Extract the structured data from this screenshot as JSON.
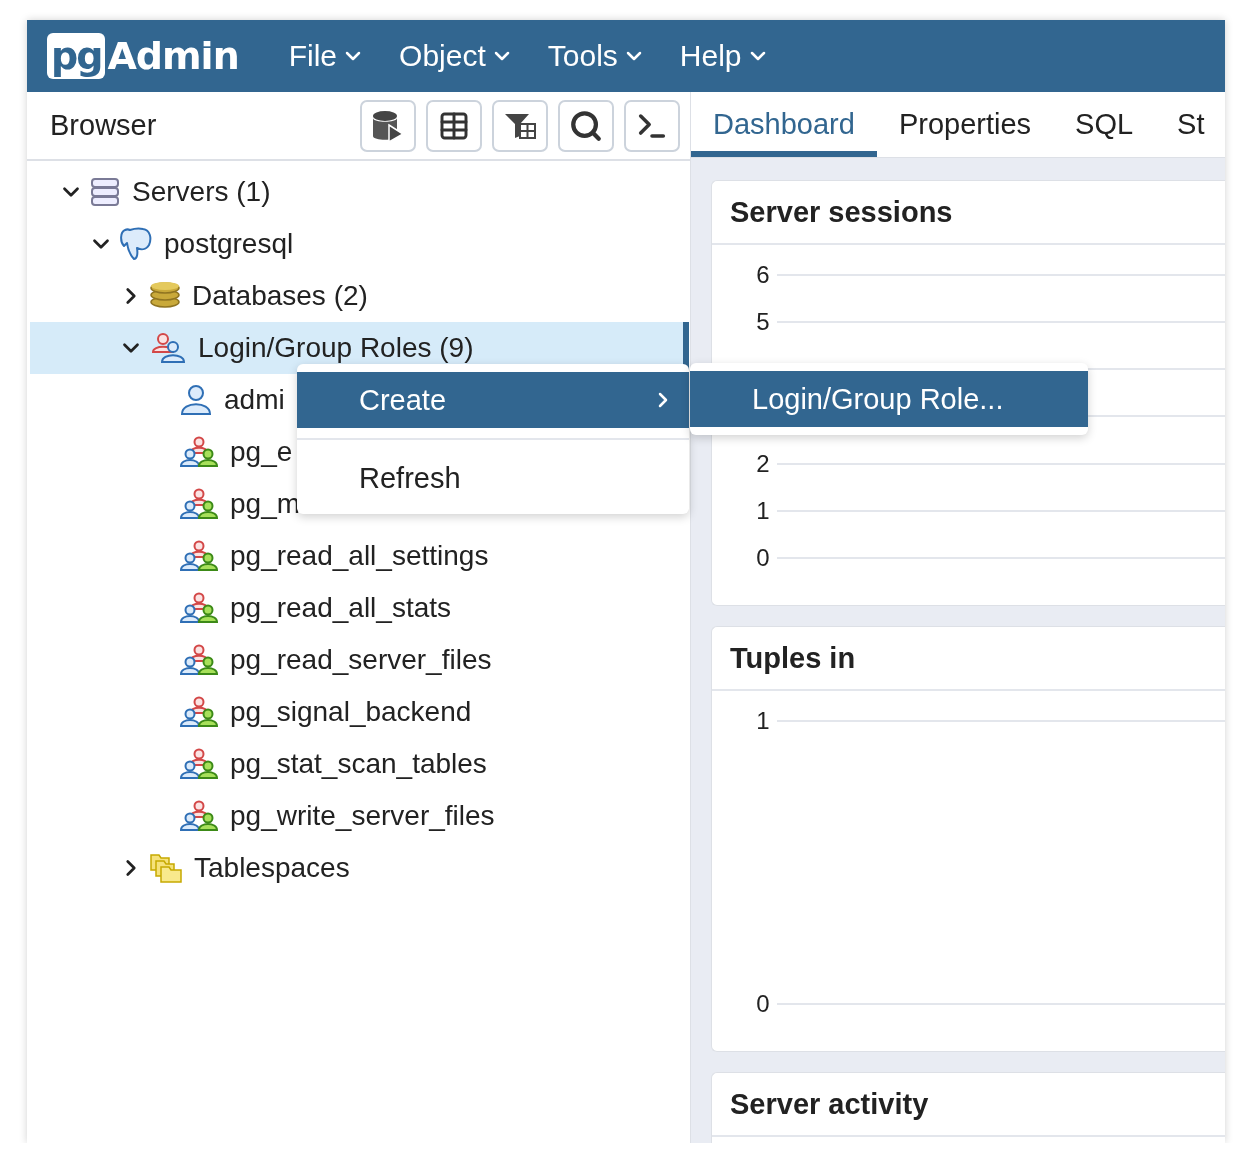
{
  "header": {
    "logo": {
      "badge": "pg",
      "text": "Admin"
    },
    "menus": [
      {
        "label": "File"
      },
      {
        "label": "Object"
      },
      {
        "label": "Tools"
      },
      {
        "label": "Help"
      }
    ]
  },
  "browser": {
    "title": "Browser",
    "tools": [
      {
        "kind": "query"
      },
      {
        "kind": "data"
      },
      {
        "kind": "filter"
      },
      {
        "kind": "search"
      },
      {
        "kind": "terminal"
      }
    ]
  },
  "tree": [
    {
      "label": "Servers (1)",
      "kind": "servers",
      "expanded": true,
      "selected": false,
      "children": [
        {
          "label": "postgresql",
          "kind": "server",
          "expanded": true,
          "selected": false,
          "children": [
            {
              "label": "Databases (2)",
              "kind": "databases",
              "expanded": false,
              "selected": false
            },
            {
              "label": "Login/Group Roles (9)",
              "kind": "roles",
              "expanded": true,
              "selected": true,
              "children": [
                {
                  "label": "admi",
                  "kind": "login",
                  "selected": false
                },
                {
                  "label": "pg_e",
                  "kind": "group",
                  "selected": false
                },
                {
                  "label": "pg_m",
                  "kind": "group",
                  "selected": false
                },
                {
                  "label": "pg_read_all_settings",
                  "kind": "group",
                  "selected": false
                },
                {
                  "label": "pg_read_all_stats",
                  "kind": "group",
                  "selected": false
                },
                {
                  "label": "pg_read_server_files",
                  "kind": "group",
                  "selected": false
                },
                {
                  "label": "pg_signal_backend",
                  "kind": "group",
                  "selected": false
                },
                {
                  "label": "pg_stat_scan_tables",
                  "kind": "group",
                  "selected": false
                },
                {
                  "label": "pg_write_server_files",
                  "kind": "group",
                  "selected": false
                }
              ]
            },
            {
              "label": "Tablespaces",
              "kind": "tablespaces",
              "expanded": false,
              "selected": false
            }
          ]
        }
      ]
    }
  ],
  "context_menu": {
    "items": [
      {
        "label": "Create",
        "selected": true,
        "has_submenu": true
      },
      {
        "label": "Refresh",
        "selected": false,
        "has_submenu": false
      }
    ]
  },
  "submenu": {
    "items": [
      {
        "label": "Login/Group Role...",
        "selected": true
      }
    ]
  },
  "tabs": [
    {
      "label": "Dashboard",
      "selected": true
    },
    {
      "label": "Properties",
      "selected": false
    },
    {
      "label": "SQL",
      "selected": false
    },
    {
      "label": "St",
      "selected": false
    }
  ],
  "cards": [
    {
      "title": "Server sessions",
      "ticks": [
        {
          "kind": "label",
          "label": "6"
        },
        {
          "kind": "label",
          "label": "5"
        },
        {
          "kind": "line"
        },
        {
          "kind": "line"
        },
        {
          "kind": "label",
          "label": "2"
        },
        {
          "kind": "label",
          "label": "1"
        },
        {
          "kind": "label",
          "label": "0"
        }
      ]
    },
    {
      "title": "Tuples in",
      "ticks": [
        {
          "kind": "label",
          "label": "1"
        },
        {
          "kind": "label",
          "label": "0"
        }
      ]
    },
    {
      "title": "Server activity"
    }
  ]
}
